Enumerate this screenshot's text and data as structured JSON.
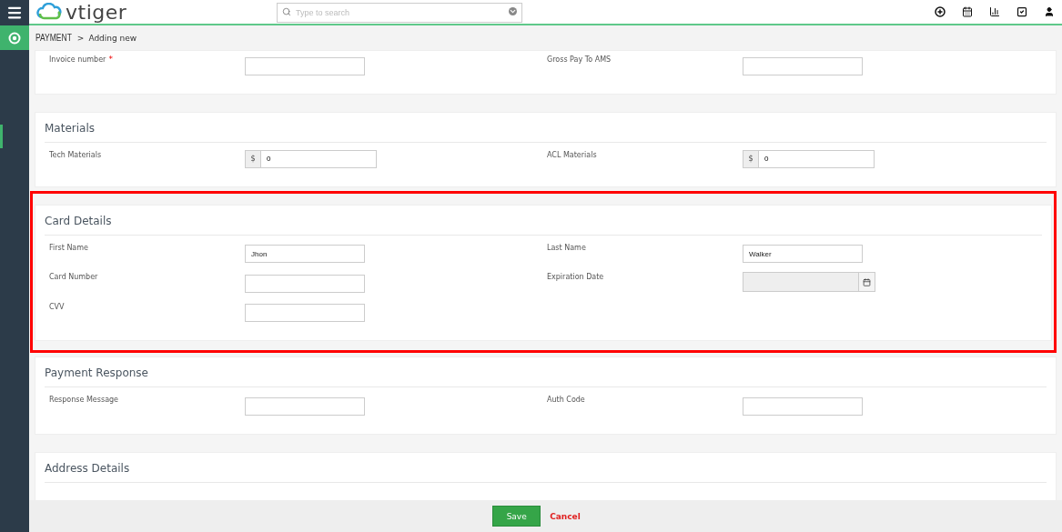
{
  "header": {
    "logo": "vtiger",
    "search": {
      "placeholder": "Type to search"
    }
  },
  "breadcrumb": {
    "module": "PAYMENT",
    "separator": ">",
    "page": "Adding new"
  },
  "sections": [
    {
      "highlighted": false,
      "fields": [
        {
          "label": "Invoice number",
          "required_mark": "*",
          "kind": "text"
        },
        {
          "label": "Gross Pay To AMS",
          "kind": "text"
        }
      ]
    },
    {
      "title": "Materials",
      "highlighted": false,
      "fields": [
        {
          "label": "Tech Materials",
          "kind": "currency",
          "currency": "$",
          "value": "0"
        },
        {
          "label": "ACL Materials",
          "kind": "currency",
          "currency": "$",
          "value": "0"
        }
      ]
    },
    {
      "title": "Card Details",
      "highlighted": true,
      "fields": [
        {
          "label": "First Name",
          "kind": "text",
          "value": "Jhon"
        },
        {
          "label": "Last Name",
          "kind": "text",
          "value": "Walker"
        },
        {
          "label": "Card Number",
          "kind": "text"
        },
        {
          "label": "Expiration Date",
          "kind": "date"
        },
        {
          "label": "CVV",
          "kind": "text"
        }
      ]
    },
    {
      "title": "Payment Response",
      "highlighted": false,
      "fields": [
        {
          "label": "Response Message",
          "kind": "text"
        },
        {
          "label": "Auth Code",
          "kind": "text"
        }
      ]
    },
    {
      "title": "Address Details",
      "highlighted": false
    }
  ],
  "footer": {
    "save": "Save",
    "cancel": "Cancel"
  }
}
